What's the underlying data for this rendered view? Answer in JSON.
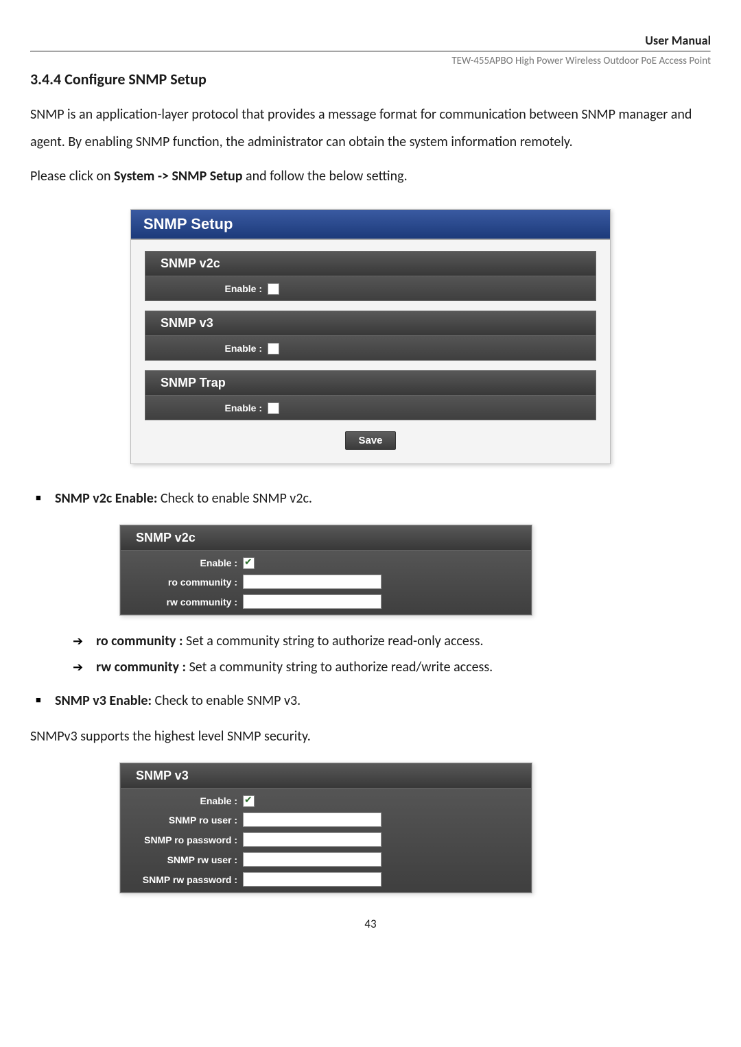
{
  "header": {
    "right_label": "User Manual",
    "product_line": "TEW-455APBO High Power Wireless Outdoor PoE Access Point"
  },
  "section_title": "3.4.4 Configure SNMP Setup",
  "intro_text": "SNMP is an application-layer protocol that provides a message format for communication between SNMP manager and agent. By enabling SNMP function, the administrator can obtain the system information remotely.",
  "nav_sentence_pre": "Please click on ",
  "nav_sentence_bold": "System -> SNMP Setup",
  "nav_sentence_post": " and follow the below setting.",
  "panel1": {
    "title": "SNMP Setup",
    "v2c": {
      "header": "SNMP v2c",
      "enable_label": "Enable :"
    },
    "v3": {
      "header": "SNMP v3",
      "enable_label": "Enable :"
    },
    "trap": {
      "header": "SNMP Trap",
      "enable_label": "Enable :"
    },
    "save_label": "Save"
  },
  "bullet1_bold": "SNMP v2c Enable:",
  "bullet1_text": " Check to enable SNMP v2c.",
  "panel2": {
    "header": "SNMP v2c",
    "enable_label": "Enable :",
    "ro_label": "ro community :",
    "rw_label": "rw community :"
  },
  "arrow1_bold": "ro community :",
  "arrow1_text": " Set a community string to authorize read-only access.",
  "arrow2_bold": "rw community :",
  "arrow2_text": " Set a community string to authorize read/write access.",
  "bullet2_bold": "SNMP v3 Enable:",
  "bullet2_text": "  Check to enable SNMP v3.",
  "v3_support_text": "SNMPv3 supports the highest level SNMP security.",
  "panel3": {
    "header": "SNMP v3",
    "enable_label": "Enable :",
    "rouser_label": "SNMP ro user :",
    "ropass_label": "SNMP ro password :",
    "rwuser_label": "SNMP rw user :",
    "rwpass_label": "SNMP rw password :"
  },
  "page_number": "43"
}
